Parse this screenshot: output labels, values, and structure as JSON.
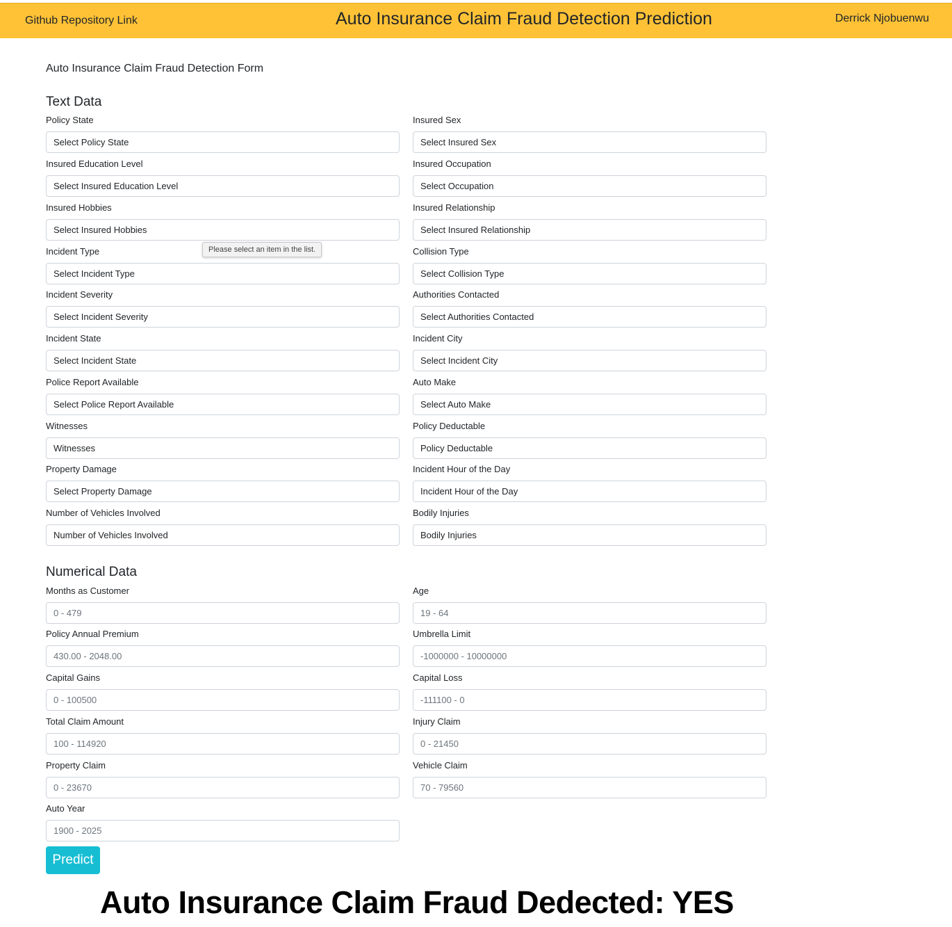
{
  "header": {
    "github_link": "Github Repository Link",
    "title": "Auto Insurance Claim Fraud Detection Prediction",
    "author": "Derrick Njobuenwu"
  },
  "form_title": "Auto Insurance Claim Fraud Detection Form",
  "text_section": {
    "heading": "Text Data",
    "fields": [
      {
        "label": "Policy State",
        "value": "Select Policy State"
      },
      {
        "label": "Insured Sex",
        "value": "Select Insured Sex"
      },
      {
        "label": "Insured Education Level",
        "value": "Select Insured Education Level"
      },
      {
        "label": "Insured Occupation",
        "value": "Select Occupation"
      },
      {
        "label": "Insured Hobbies",
        "value": "Select Insured Hobbies"
      },
      {
        "label": "Insured Relationship",
        "value": "Select Insured Relationship"
      },
      {
        "label": "Incident Type",
        "value": "Select Incident Type"
      },
      {
        "label": "Collision Type",
        "value": "Select Collision Type"
      },
      {
        "label": "Incident Severity",
        "value": "Select Incident Severity"
      },
      {
        "label": "Authorities Contacted",
        "value": "Select Authorities Contacted"
      },
      {
        "label": "Incident State",
        "value": "Select Incident State"
      },
      {
        "label": "Incident City",
        "value": "Select Incident City"
      },
      {
        "label": "Police Report Available",
        "value": "Select Police Report Available"
      },
      {
        "label": "Auto Make",
        "value": "Select Auto Make"
      },
      {
        "label": "Witnesses",
        "value": "Witnesses"
      },
      {
        "label": "Policy Deductable",
        "value": "Policy Deductable"
      },
      {
        "label": "Property Damage",
        "value": "Select Property Damage"
      },
      {
        "label": "Incident Hour of the Day",
        "value": "Incident Hour of the Day"
      },
      {
        "label": "Number of Vehicles Involved",
        "value": "Number of Vehicles Involved"
      },
      {
        "label": "Bodily Injuries",
        "value": "Bodily Injuries"
      }
    ]
  },
  "validation_tooltip": "Please select an item in the list.",
  "numerical_section": {
    "heading": "Numerical Data",
    "fields": [
      {
        "label": "Months as Customer",
        "placeholder": "0 - 479"
      },
      {
        "label": "Age",
        "placeholder": "19 - 64"
      },
      {
        "label": "Policy Annual Premium",
        "placeholder": "430.00 - 2048.00"
      },
      {
        "label": "Umbrella Limit",
        "placeholder": "-1000000 - 10000000"
      },
      {
        "label": "Capital Gains",
        "placeholder": "0 - 100500"
      },
      {
        "label": "Capital Loss",
        "placeholder": "-111100 - 0"
      },
      {
        "label": "Total Claim Amount",
        "placeholder": "100 - 114920"
      },
      {
        "label": "Injury Claim",
        "placeholder": "0 - 21450"
      },
      {
        "label": "Property Claim",
        "placeholder": "0 - 23670"
      },
      {
        "label": "Vehicle Claim",
        "placeholder": "70 - 79560"
      },
      {
        "label": "Auto Year",
        "placeholder": "1900 - 2025"
      }
    ]
  },
  "predict_label": "Predict",
  "result_text": "Auto Insurance Claim Fraud Dedected: YES",
  "colors": {
    "header_bg": "#ffc236",
    "predict_button": "#17bed3"
  }
}
